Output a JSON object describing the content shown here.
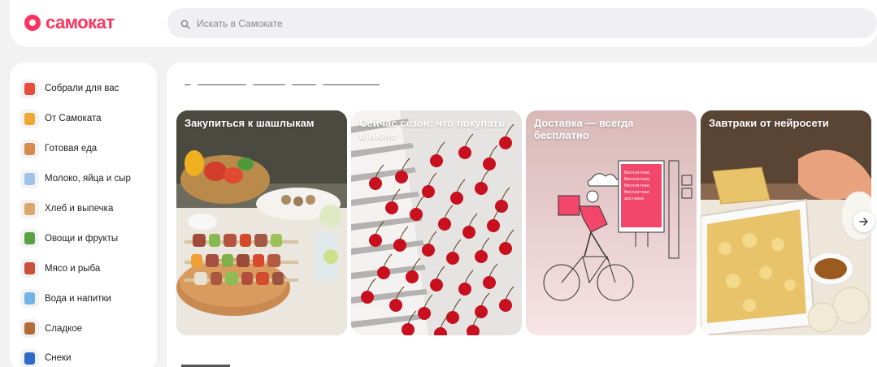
{
  "header": {
    "brand": "самокат",
    "search_placeholder": "Искать в Самокате"
  },
  "sidebar": {
    "items": [
      {
        "label": "Собрали для вас",
        "icon": "collection-icon",
        "color": "#e74c3c"
      },
      {
        "label": "От Самоката",
        "icon": "own-brand-icon",
        "color": "#f0a830"
      },
      {
        "label": "Готовая еда",
        "icon": "ready-meal-icon",
        "color": "#d98b4b"
      },
      {
        "label": "Молоко, яйца и сыр",
        "icon": "dairy-icon",
        "color": "#9fc3e8"
      },
      {
        "label": "Хлеб и выпечка",
        "icon": "bread-icon",
        "color": "#d9a86a"
      },
      {
        "label": "Овощи и фрукты",
        "icon": "vegetables-icon",
        "color": "#5aa343"
      },
      {
        "label": "Мясо и рыба",
        "icon": "meat-icon",
        "color": "#c94f3d"
      },
      {
        "label": "Вода и напитки",
        "icon": "water-icon",
        "color": "#6fb5e8"
      },
      {
        "label": "Сладкое",
        "icon": "sweets-icon",
        "color": "#b36b3a"
      },
      {
        "label": "Снеки",
        "icon": "snacks-icon",
        "color": "#2e6bc9"
      }
    ]
  },
  "stories": [
    {
      "title": "Закупиться к шашлыкам",
      "name": "story-card-bbq"
    },
    {
      "title": "Сейчас сезон: что покупать в июне",
      "name": "story-card-season"
    },
    {
      "title": "Доставка — всегда бесплатно",
      "name": "story-card-free-delivery"
    },
    {
      "title": "Завтраки от нейросети",
      "name": "story-card-breakfast"
    }
  ],
  "delivery_poster_text": "бесплатная, бесплатная, бесплатная, бесплатная доставка",
  "colors": {
    "brand": "#ff335f",
    "background": "#f2f2f2"
  }
}
